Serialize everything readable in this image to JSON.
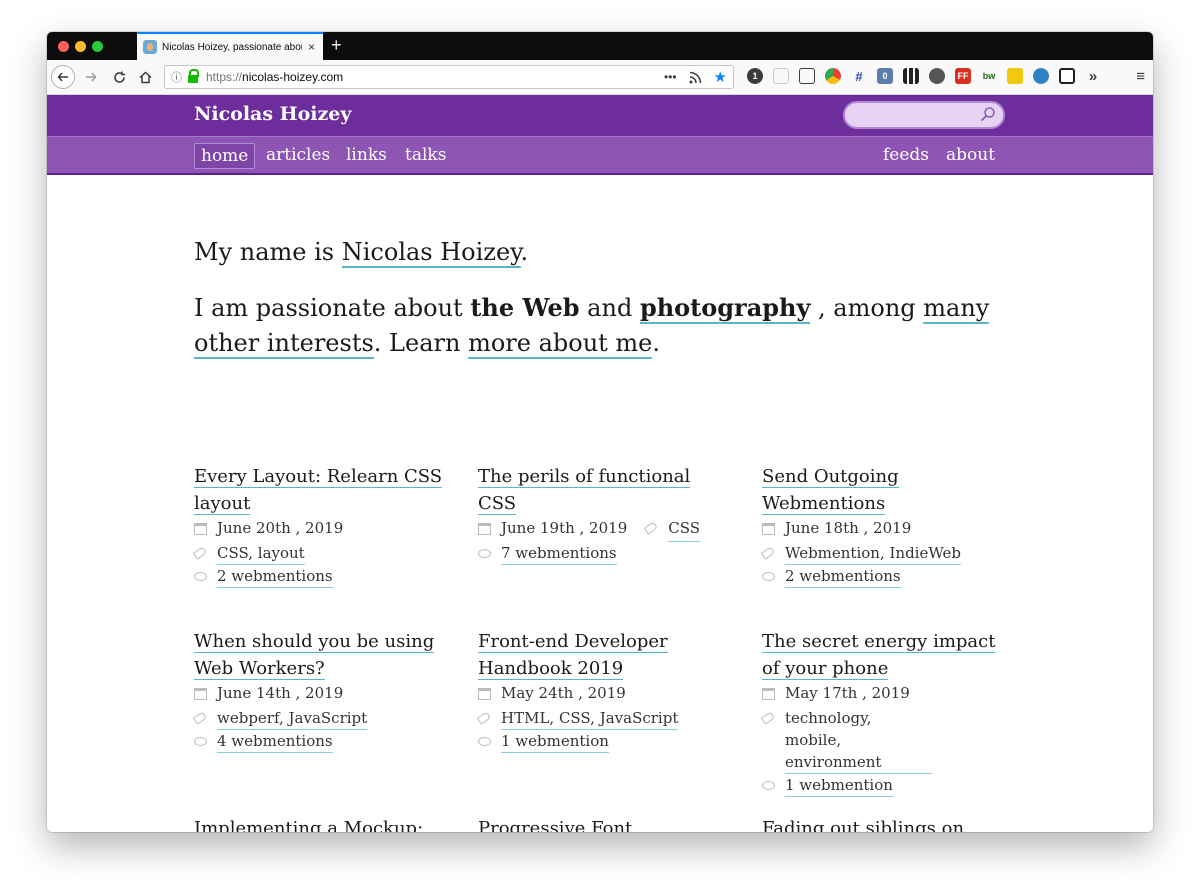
{
  "browser": {
    "tab_title": "Nicolas Hoizey, passionate about",
    "tab_close": "×",
    "new_tab": "+",
    "url_scheme": "https://",
    "url_host": "nicolas-hoizey.com",
    "page_actions": "•••",
    "overflow": "»",
    "menu": "≡"
  },
  "site": {
    "title": "Nicolas Hoizey",
    "search_placeholder": "",
    "nav_left": [
      "home",
      "articles",
      "links",
      "talks"
    ],
    "nav_right": [
      "feeds",
      "about"
    ],
    "active_nav": "home"
  },
  "intro": {
    "line1_prefix": "My name is ",
    "line1_link": "Nicolas Hoizey",
    "line1_suffix": ".",
    "line2_a": "I am passionate about ",
    "line2_bold": "the Web",
    "line2_b": " and ",
    "line2_link_bold": "photography",
    "line2_c": " , among ",
    "line2_link": "many other interests",
    "line2_d": ". Learn ",
    "line2_link2": "more about me",
    "line2_e": "."
  },
  "articles": [
    {
      "title": "Every Layout: Relearn CSS layout",
      "date": "June 20th , 2019",
      "tags": "CSS, layout",
      "mentions": "2 webmentions"
    },
    {
      "title": "The perils of functional CSS",
      "date": "June 19th , 2019",
      "tags": "CSS",
      "mentions": "7 webmentions"
    },
    {
      "title": "Send Outgoing Webmentions",
      "date": "June 18th , 2019",
      "tags": "Webmention, IndieWeb",
      "mentions": "2 webmentions"
    },
    {
      "title": "When should you be using Web Workers?",
      "date": "June 14th , 2019",
      "tags": "webperf, JavaScript",
      "mentions": "4 webmentions"
    },
    {
      "title": "Front-end Developer Handbook 2019",
      "date": "May 24th , 2019",
      "tags": "HTML, CSS, JavaScript",
      "mentions": "1 webmention"
    },
    {
      "title": "The secret energy impact of your phone",
      "date": "May 17th , 2019",
      "tags": "technology, mobile, environment",
      "mentions": "1 webmention"
    },
    {
      "title": "Implementing a Mockup: CSS Layout Step by Step",
      "date": "",
      "tags": "",
      "mentions": ""
    },
    {
      "title": "Progressive Font Enrichment: reinventing",
      "date": "",
      "tags": "",
      "mentions": ""
    },
    {
      "title": "Fading out siblings on hover in CSS",
      "date": "",
      "tags": "",
      "mentions": ""
    }
  ],
  "colors": {
    "masthead": "#6d2d9b",
    "navbar": "#8e55b5",
    "link_underline": "#5cb4c8"
  }
}
